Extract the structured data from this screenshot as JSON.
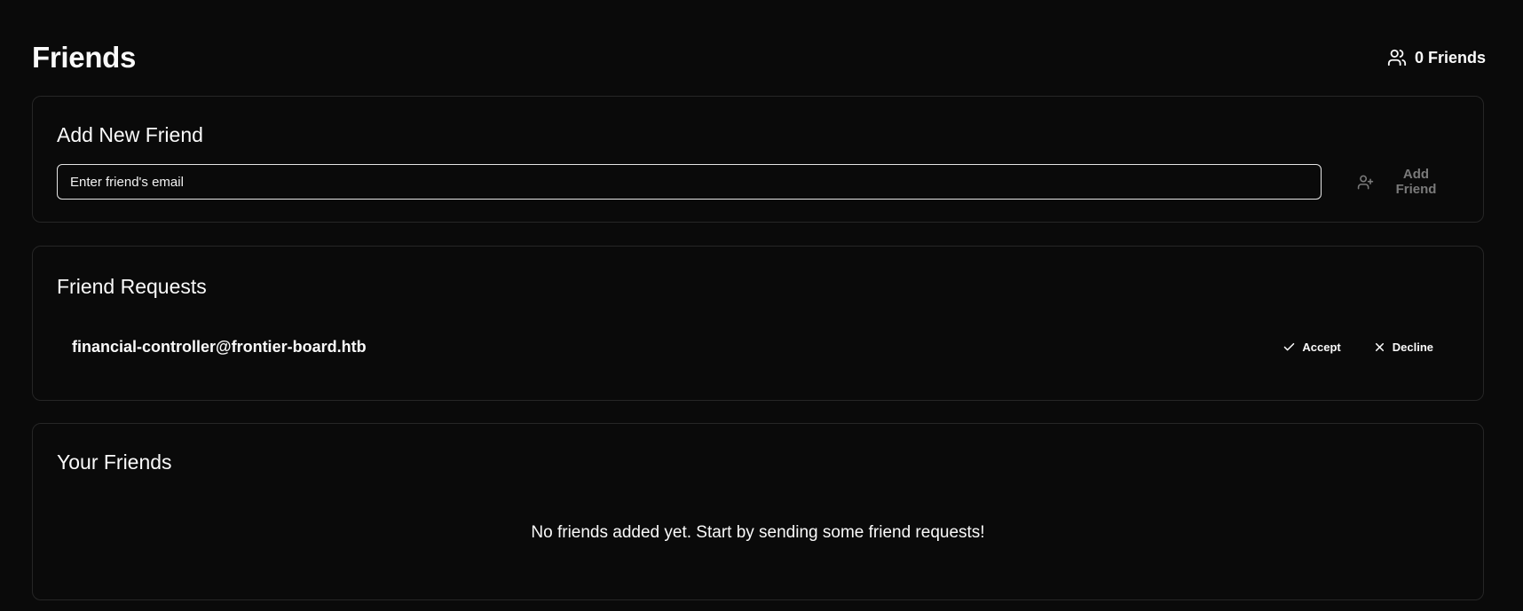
{
  "page": {
    "title": "Friends",
    "friend_count_label": "0 Friends"
  },
  "add_friend": {
    "title": "Add New Friend",
    "email_placeholder": "Enter friend's email",
    "email_value": "",
    "button_label": "Add Friend"
  },
  "requests": {
    "title": "Friend Requests",
    "items": [
      {
        "email": "financial-controller@frontier-board.htb",
        "accept_label": "Accept",
        "decline_label": "Decline"
      }
    ]
  },
  "friends": {
    "title": "Your Friends",
    "empty_message": "No friends added yet. Start by sending some friend requests!"
  },
  "icons": {
    "friend_count": "users-icon",
    "add_friend": "user-plus-icon",
    "accept": "check-icon",
    "decline": "x-icon"
  },
  "colors": {
    "background": "#0a0a0a",
    "border": "#262626",
    "text": "#fafafa",
    "disabled_text": "#7a7a7a"
  }
}
